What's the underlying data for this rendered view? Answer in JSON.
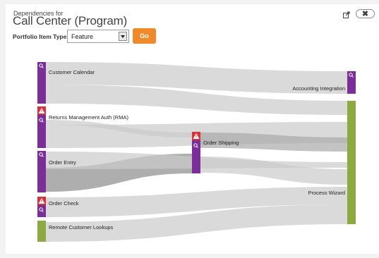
{
  "header": {
    "subtitle": "Dependencies for",
    "title": "Call Center (Program)"
  },
  "toolbar": {
    "portfolio_item_type_label": "Portfolio Item Type",
    "portfolio_item_type_value": "Feature",
    "go_label": "Go",
    "close_label": "✖"
  },
  "colors": {
    "feature_purple": "#7b2e97",
    "process_green": "#8ea842",
    "warning_red": "#d9303a",
    "go_orange": "#ef8a2b",
    "link_gray": "#c9c9c9"
  },
  "nodes": [
    {
      "name": "Customer Calendar",
      "color": "purple",
      "icons": [
        "magnifier-icon"
      ]
    },
    {
      "name": "Returns Management Auth (RMA)",
      "color": "purple",
      "icons": [
        "warning-icon",
        "magnifier-icon"
      ]
    },
    {
      "name": "Order Entry",
      "color": "purple",
      "icons": [
        "magnifier-icon"
      ]
    },
    {
      "name": "Order Check",
      "color": "purple",
      "icons": [
        "warning-icon",
        "magnifier-icon"
      ]
    },
    {
      "name": "Remote Customer Lookups",
      "color": "green",
      "icons": []
    },
    {
      "name": "Order Shipping",
      "color": "purple",
      "icons": [
        "warning-icon",
        "magnifier-icon"
      ]
    },
    {
      "name": "Accounting Integration",
      "color": "purple",
      "icons": [
        "magnifier-icon"
      ]
    },
    {
      "name": "Process Wizard",
      "color": "green",
      "icons": []
    }
  ]
}
